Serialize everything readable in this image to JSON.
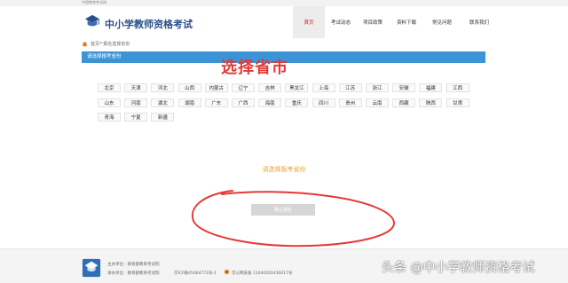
{
  "top_strip": {
    "text": "中国教育考试网"
  },
  "header": {
    "logo_text": "中小学教师资格考试",
    "nav": [
      {
        "label": "首页",
        "active": true
      },
      {
        "label": "考试动态",
        "active": false
      },
      {
        "label": "项目政策",
        "active": false
      },
      {
        "label": "资料下载",
        "active": false
      },
      {
        "label": "常见问题",
        "active": false
      },
      {
        "label": "联系我们",
        "active": false
      }
    ]
  },
  "breadcrumb": {
    "home": "首页",
    "separator": " > ",
    "current": "报名选择省份"
  },
  "section_bar": {
    "title": "请选择报考省份"
  },
  "overlay_title": "选择省市",
  "provinces": [
    [
      "北京",
      "天津",
      "河北",
      "山西",
      "内蒙古",
      "辽宁",
      "吉林",
      "黑龙江",
      "上海",
      "江苏",
      "浙江",
      "安徽",
      "福建",
      "江西"
    ],
    [
      "山东",
      "河南",
      "湖北",
      "湖南",
      "广东",
      "广西",
      "海南",
      "重庆",
      "四川",
      "贵州",
      "云南",
      "西藏",
      "陕西",
      "甘肃"
    ],
    [
      "青海",
      "宁夏",
      "新疆"
    ]
  ],
  "prompt": "请选择报考省份",
  "confirm_button": "确认报名",
  "footer": {
    "sponsor": "主办单位：教育部教育考试院",
    "operator": "承办单位：教育部教育考试院",
    "icp": "京ICP备05064772号-1",
    "beian": "京公网安备 11040202430017号"
  },
  "watermark": "头条 @中小学教师资格考试",
  "colors": {
    "primary_blue": "#3c94d6",
    "accent_red": "#e53935",
    "prompt_orange": "#f0a030",
    "logo_blue": "#2a4f8a"
  }
}
